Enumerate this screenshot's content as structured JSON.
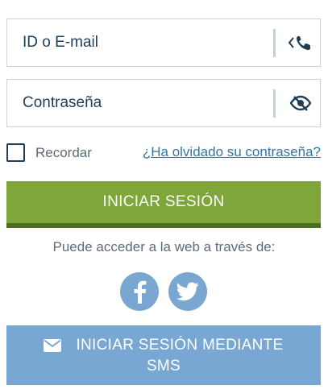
{
  "login_form": {
    "id_field": {
      "placeholder": "ID o E-mail",
      "icon": "phone-switch-icon"
    },
    "password_field": {
      "placeholder": "Contraseña",
      "icon": "eye-slash-icon"
    },
    "remember_label": "Recordar",
    "remember_checked": false,
    "forgot_link": "¿Ha olvidado su contraseña?",
    "login_button": "INICIAR SESIÓN"
  },
  "social": {
    "access_text": "Puede acceder a la web a través de:",
    "facebook_icon": "facebook-icon",
    "twitter_icon": "twitter-icon"
  },
  "sms": {
    "label_line1": "INICIAR SESIÓN MEDIANTE",
    "label_line2": "SMS",
    "icon": "envelope-icon"
  },
  "colors": {
    "text_dark": "#1f3d57",
    "green_button": "#7ea63b",
    "blue_button": "#78a7d3",
    "link": "#2d78a8"
  }
}
